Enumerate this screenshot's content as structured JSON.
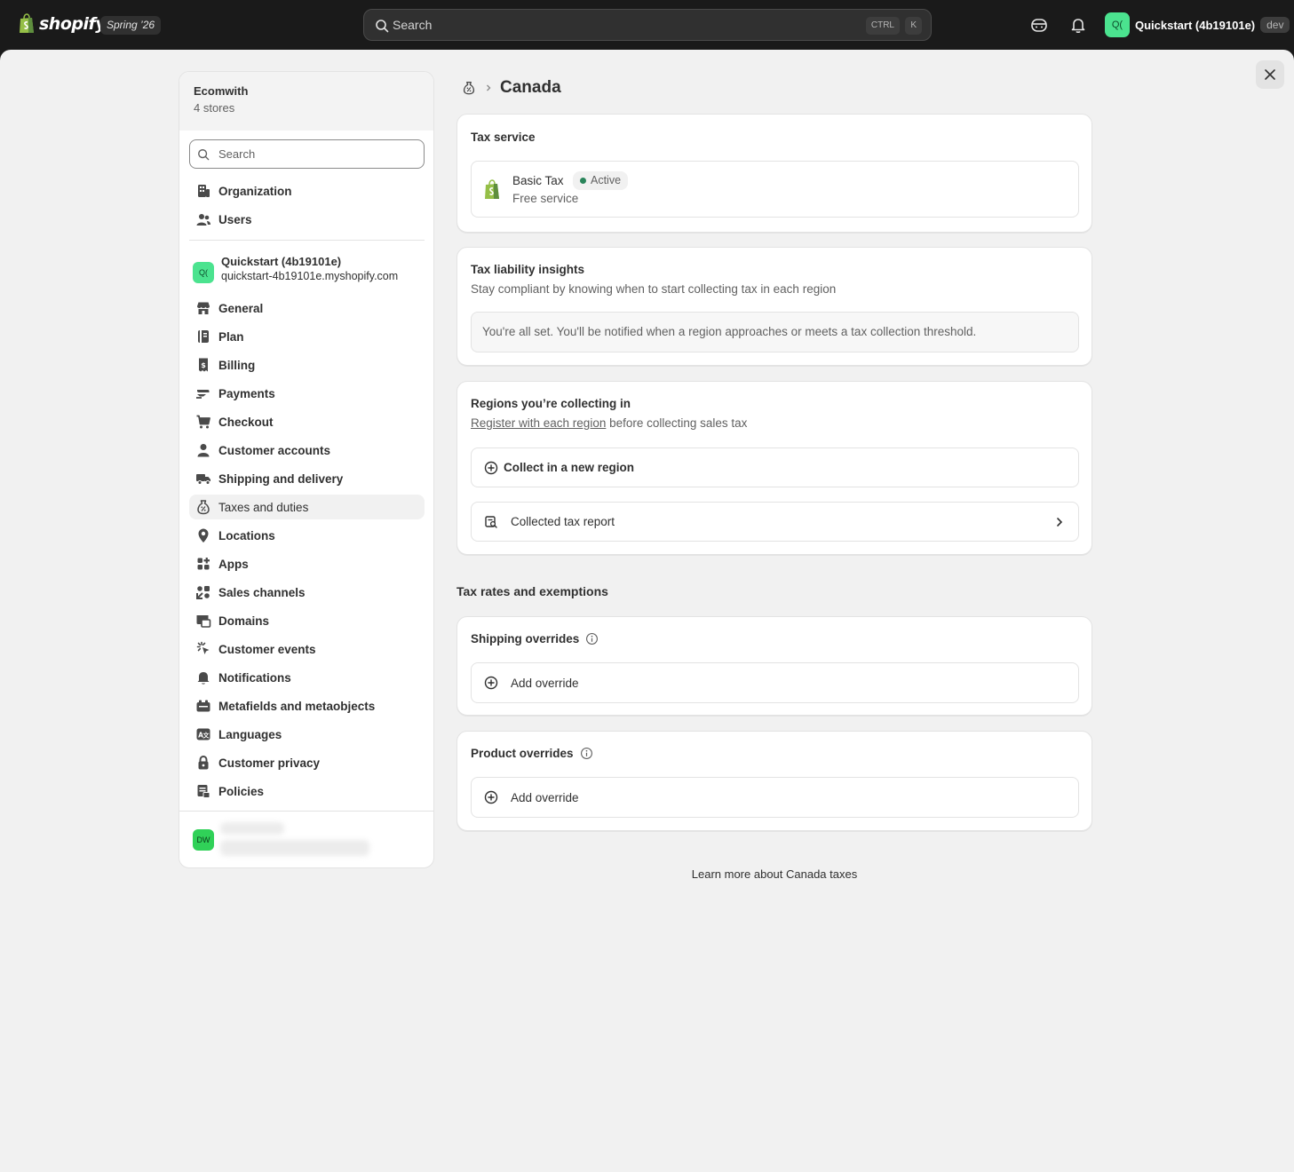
{
  "topbar": {
    "logo_text": "shopify",
    "edition": "Spring ’26",
    "search_placeholder": "Search",
    "shortcut_ctrl": "CTRL",
    "shortcut_key": "K",
    "store_avatar": "Q(",
    "store_name": "Quickstart (4b19101e)",
    "store_badge": "dev"
  },
  "sidebar": {
    "org_name": "Ecomwith",
    "org_sub": "4 stores",
    "search_placeholder": "Search",
    "top_items": [
      {
        "label": "Organization",
        "icon": "building-icon"
      },
      {
        "label": "Users",
        "icon": "users-icon"
      }
    ],
    "store": {
      "avatar": "Q(",
      "name": "Quickstart (4b19101e)",
      "url": "quickstart-4b19101e.myshopify.com"
    },
    "items": [
      {
        "label": "General",
        "icon": "store-icon"
      },
      {
        "label": "Plan",
        "icon": "plan-icon"
      },
      {
        "label": "Billing",
        "icon": "receipt-icon"
      },
      {
        "label": "Payments",
        "icon": "payments-icon"
      },
      {
        "label": "Checkout",
        "icon": "cart-icon"
      },
      {
        "label": "Customer accounts",
        "icon": "person-icon"
      },
      {
        "label": "Shipping and delivery",
        "icon": "truck-icon"
      },
      {
        "label": "Taxes and duties",
        "icon": "tax-icon",
        "active": true
      },
      {
        "label": "Locations",
        "icon": "location-icon"
      },
      {
        "label": "Apps",
        "icon": "apps-icon"
      },
      {
        "label": "Sales channels",
        "icon": "channels-icon"
      },
      {
        "label": "Domains",
        "icon": "domain-icon"
      },
      {
        "label": "Customer events",
        "icon": "cursor-icon"
      },
      {
        "label": "Notifications",
        "icon": "bell-icon"
      },
      {
        "label": "Metafields and metaobjects",
        "icon": "metafields-icon"
      },
      {
        "label": "Languages",
        "icon": "language-icon"
      },
      {
        "label": "Customer privacy",
        "icon": "lock-icon"
      },
      {
        "label": "Policies",
        "icon": "policy-icon"
      }
    ],
    "user_avatar": "DW"
  },
  "page": {
    "title": "Canada",
    "tax_service": {
      "title": "Tax service",
      "name": "Basic Tax",
      "status": "Active",
      "subtitle": "Free service",
      "status_color": "#29845a"
    },
    "insights": {
      "title": "Tax liability insights",
      "subtitle": "Stay compliant by knowing when to start collecting tax in each region",
      "notice": "You're all set. You'll be notified when a region approaches or meets a tax collection threshold."
    },
    "regions": {
      "title": "Regions you’re collecting in",
      "link": "Register with each region",
      "subtitle_rest": " before collecting sales tax",
      "collect_label": "Collect in a new region",
      "report_label": "Collected tax report"
    },
    "section_heading": "Tax rates and exemptions",
    "shipping_overrides": {
      "title": "Shipping overrides",
      "add_label": "Add override"
    },
    "product_overrides": {
      "title": "Product overrides",
      "add_label": "Add override"
    },
    "learn_more": "Learn more about Canada taxes"
  }
}
